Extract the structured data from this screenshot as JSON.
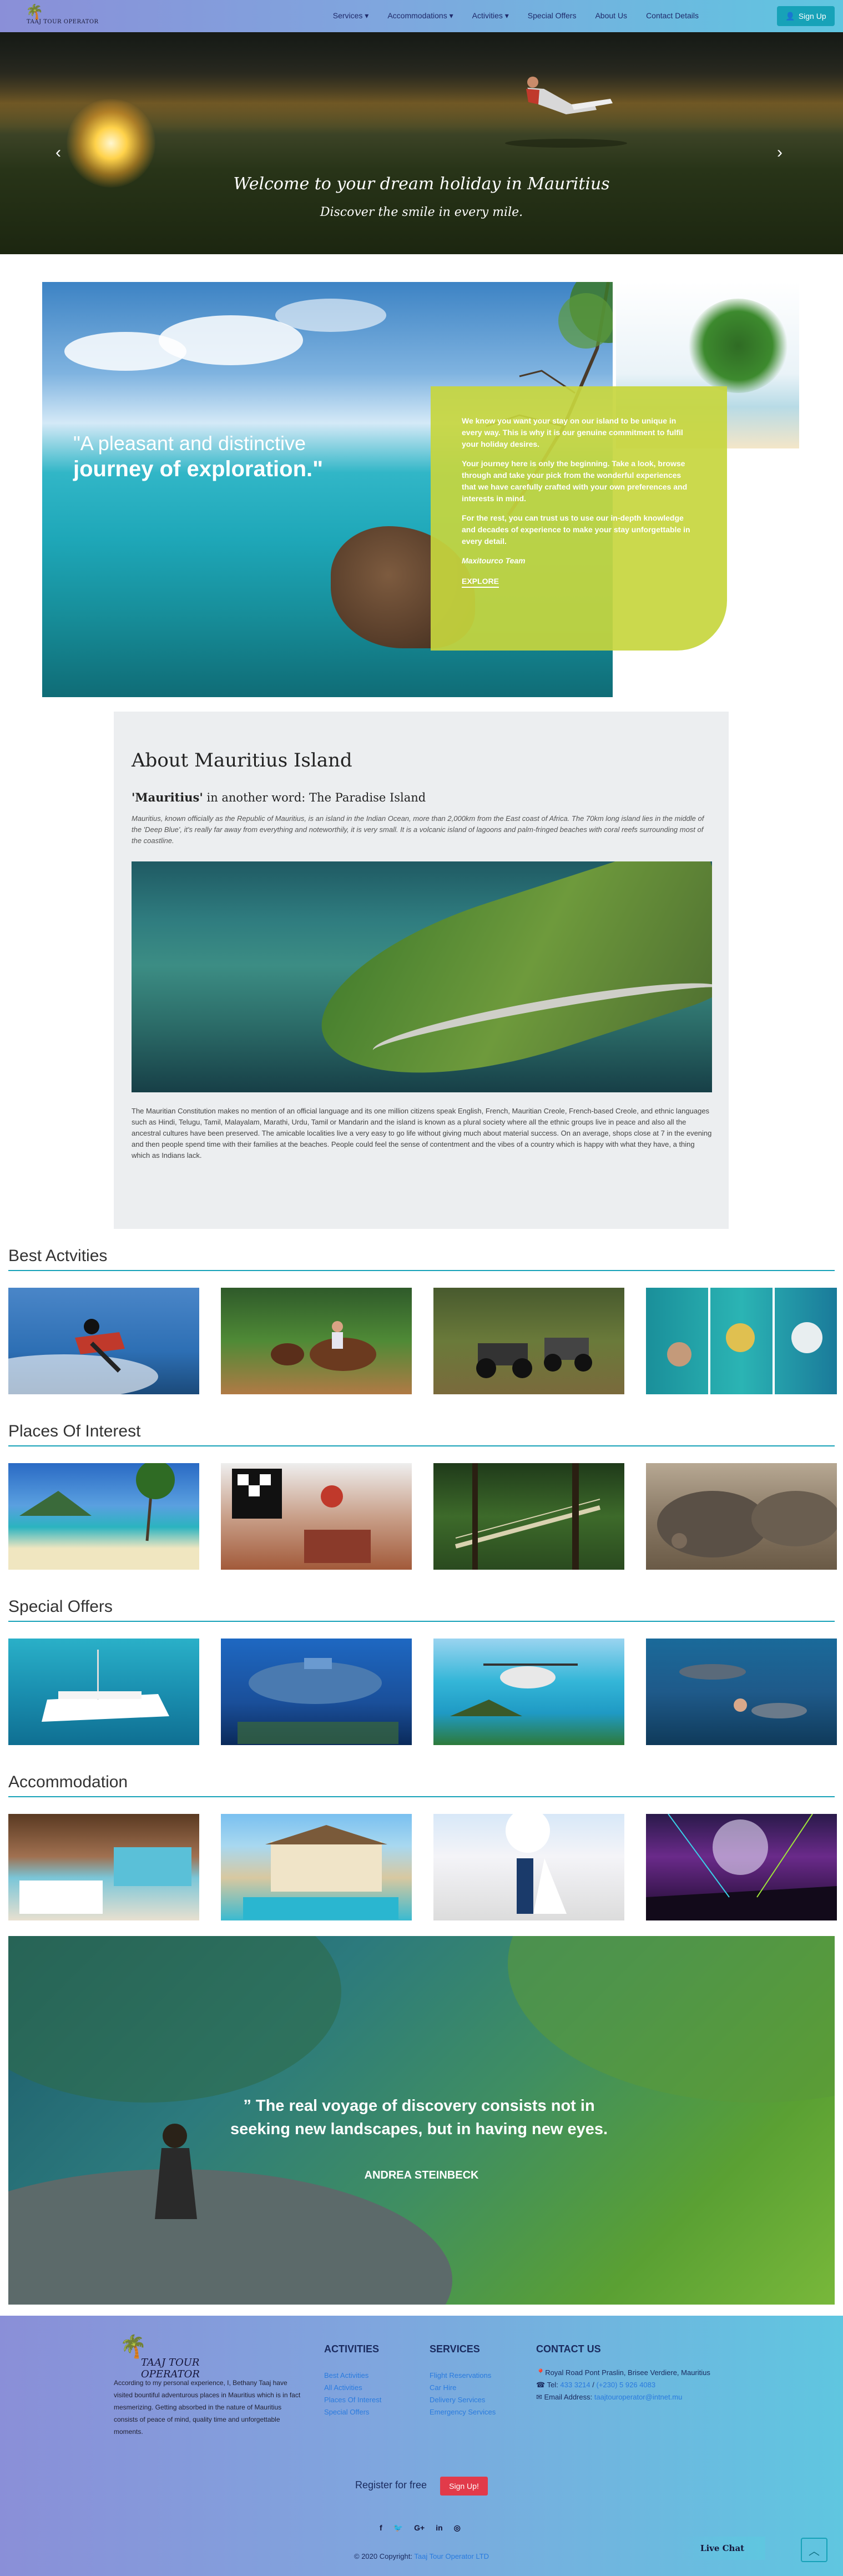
{
  "nav": {
    "logo_text": "TAAJ TOUR OPERATOR",
    "items": [
      {
        "label": "Services ▾"
      },
      {
        "label": "Accommodations ▾"
      },
      {
        "label": "Activities ▾"
      },
      {
        "label": "Special Offers"
      },
      {
        "label": "About Us"
      },
      {
        "label": "Contact Details"
      }
    ],
    "signup_label": "Sign Up"
  },
  "hero": {
    "title": "Welcome to your dream holiday in Mauritius",
    "subtitle": "Discover the smile in every mile."
  },
  "promo": {
    "quote_line1": "\"A pleasant and distinctive",
    "quote_line2": "journey of exploration.\"",
    "p1": "We know you want your stay on our island to be unique in every way. This is why it is our genuine commitment to fulfil your holiday desires.",
    "p2": "Your journey here is only the beginning. Take a look, browse through and take your pick from the wonderful experiences that we have carefully crafted with your own preferences and interests in mind.",
    "p3": "For the rest, you can trust us to use our in-depth knowledge and decades of experience to make your stay unforgettable in every detail.",
    "team": "Maxitourco Team",
    "explore": "EXPLORE"
  },
  "about": {
    "title": "About Mauritius Island",
    "sub_bold": "'Mauritius'",
    "sub_rest": " in another word: The Paradise Island",
    "intro": "Mauritius, known officially as the Republic of Mauritius, is an island in the Indian Ocean, more than 2,000km from the East coast of Africa. The 70km long island lies in the middle of the 'Deep Blue', it's really far away from everything and noteworthily, it is very small. It is a volcanic island of lagoons and palm-fringed beaches with coral reefs surrounding most of the coastline.",
    "body": "The Mauritian Constitution makes no mention of an official language and its one million citizens speak English, French, Mauritian Creole, French-based Creole, and ethnic languages such as Hindi, Telugu, Tamil, Malayalam, Marathi, Urdu, Tamil or Mandarin and the island is known as a plural society where all the ethnic groups live in peace and also all the ancestral cultures have been preserved. The amicable localities live a very easy to go life without giving much about material success. On an average, shops close at 7 in the evening and then people spend time with their families at the beaches. People could feel the sense of contentment and the vibes of a country which is happy with what they have, a thing which as Indians lack."
  },
  "sections": [
    {
      "title": "Best Actvities"
    },
    {
      "title": "Places Of Interest"
    },
    {
      "title": "Special Offers"
    },
    {
      "title": "Accommodation"
    }
  ],
  "banner": {
    "quote": "” The real voyage of discovery consists not in seeking new landscapes, but in having new eyes.",
    "author": "ANDREA STEINBECK"
  },
  "footer": {
    "logo_text": "TAAJ TOUR OPERATOR",
    "description": "According to my personal experience, I, Bethany Taaj have visited bountiful adventurous places in Mauritius which is in fact mesmerizing. Getting absorbed in the nature of Mauritius consists of peace of mind, quality time and unforgettable moments.",
    "activities_heading": "ACTIVITIES",
    "activities": [
      "Best Activities",
      "All Activities",
      "Places Of Interest",
      "Special Offers"
    ],
    "services_heading": "SERVICES",
    "services": [
      "Flight Reservations",
      "Car Hire",
      "Delivery Services",
      "Emergency Services"
    ],
    "contact_heading": "CONTACT US",
    "address": "Royal Road Pont Praslin, Brisee Verdiere, Mauritius",
    "tel_label": "Tel: ",
    "tel1": "433 3214",
    "tel_sep": " / ",
    "tel2": "(+230) 5 926 4083",
    "email_label": "Email Address: ",
    "email": "taajtouroperator@intnet.mu",
    "register_text": "Register for free",
    "register_button": "Sign Up!",
    "copyright_prefix": "© 2020 Copyright: ",
    "copyright_link": "Taaj Tour Operator LTD",
    "live_chat": "Live Chat"
  },
  "icons": {
    "social": [
      "f",
      "🐦",
      "G+",
      "in",
      "◎"
    ]
  }
}
